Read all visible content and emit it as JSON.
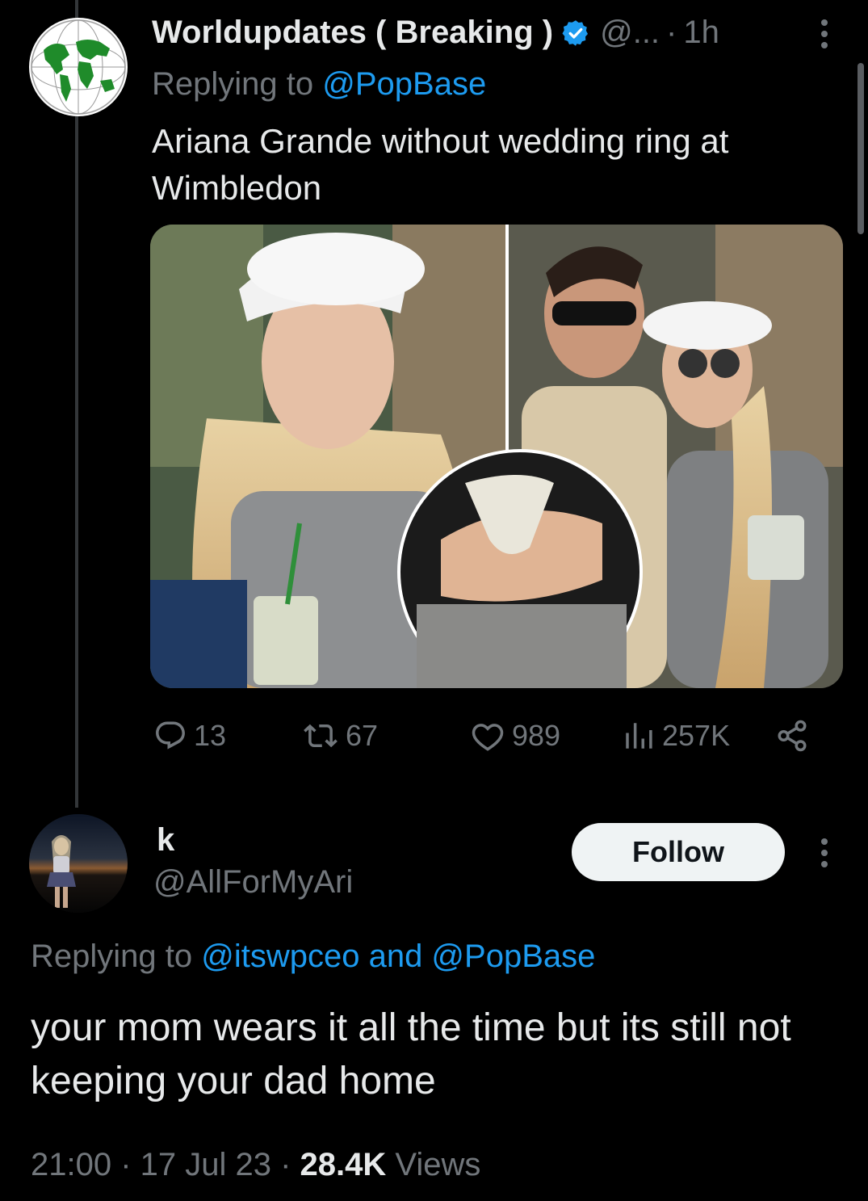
{
  "tweet1": {
    "display_name": "Worldupdates ( Breaking )",
    "handle_truncated": "@...",
    "separator": "·",
    "time": "1h",
    "replying_prefix": "Replying to ",
    "replying_to": "@PopBase",
    "text": "Ariana Grande without wedding ring at Wimbledon",
    "actions": {
      "replies": "13",
      "retweets": "67",
      "likes": "989",
      "views": "257K"
    }
  },
  "tweet2": {
    "display_name": "k",
    "handle": "@AllForMyAri",
    "follow_label": "Follow",
    "replying_prefix": "Replying to ",
    "replying_to": "@itswpceo and @PopBase",
    "text": "your mom wears it all the time but its still not keeping your dad home",
    "time": "21:00",
    "sep1": " · ",
    "date": "17 Jul 23",
    "sep2": " · ",
    "views_count": "28.4K",
    "views_label": " Views"
  },
  "colors": {
    "background": "#000000",
    "text": "#e7e9ea",
    "muted": "#71767b",
    "accent": "#1d9bf0",
    "follow_bg": "#eff3f4"
  },
  "icons": [
    "globe-icon",
    "verified-badge-icon",
    "more-icon",
    "reply-icon",
    "retweet-icon",
    "like-icon",
    "views-icon",
    "share-icon"
  ]
}
